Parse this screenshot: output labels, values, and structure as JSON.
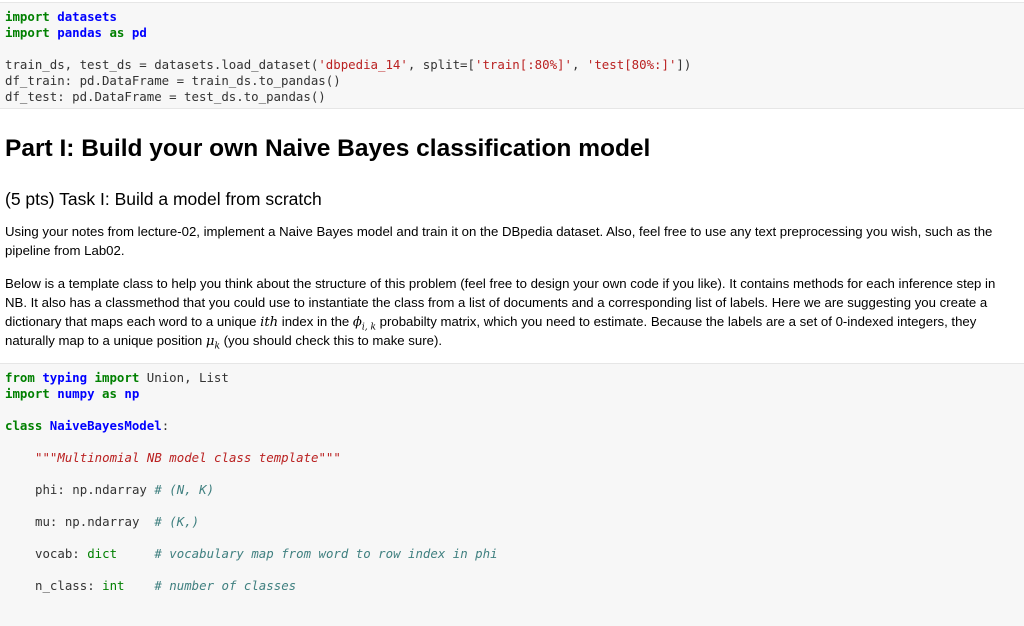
{
  "cell1": {
    "kw_import": "import",
    "mod_datasets": "datasets",
    "mod_pandas": "pandas",
    "kw_as": "as",
    "alias_pd": "pd",
    "load_pre": "train_ds, test_ds = datasets.load_dataset(",
    "str_name": "'dbpedia_14'",
    "split_pre": ", split=[",
    "str_train": "'train[:80%]'",
    "comma": ", ",
    "str_test": "'test[80%:]'",
    "close": "])",
    "df_train": "df_train: pd.DataFrame = train_ds.to_pandas()",
    "df_test": "df_test: pd.DataFrame = test_ds.to_pandas()"
  },
  "markdown": {
    "heading1": "Part I: Build your own Naive Bayes classification model",
    "heading3": "(5 pts) Task I: Build a model from scratch",
    "para1_line1": "Using your notes from lecture-02, implement a Naive Bayes model and train it on the DBpedia dataset. Also, feel free to use any text preprocessing you wish, such as the",
    "para1_line2": "pipeline from Lab02.",
    "para2_line1": "Below is a template class to help you think about the structure of this problem (feel free to design your own code if you like). It contains methods for each inference step in",
    "para2_line2": "NB. It also has a classmethod that you could use to instantiate the class from a list of documents and a corresponding list of labels. Here we are suggesting you create a",
    "para2_line3_a": "dictionary that maps each word to a unique ",
    "math_ith": "ith",
    "para2_line3_b": " index in the ",
    "math_phi": "ϕ",
    "math_phi_sub": "i, k",
    "para2_line3_c": " probabilty matrix, which you need to estimate. Because the labels are a set of 0-indexed integers, they",
    "para2_line4_a": "naturally map to a unique position ",
    "math_mu": "μ",
    "math_mu_sub": "k",
    "para2_line4_b": " (you should check this to make sure)."
  },
  "cell2": {
    "kw_from": "from",
    "mod_typing": "typing",
    "kw_import": "import",
    "typing_names": " Union, List",
    "mod_numpy": "numpy",
    "kw_as": "as",
    "alias_np": "np",
    "kw_class": "class",
    "class_name": "NaiveBayesModel",
    "colon": ":",
    "docstring": "\"\"\"Multinomial NB model class template\"\"\"",
    "phi_decl": "phi: np.ndarray ",
    "phi_comment": "# (N, K)",
    "mu_decl": "mu: np.ndarray  ",
    "mu_comment": "# (K,)",
    "vocab_decl": "vocab: ",
    "type_dict": "dict",
    "vocab_pad": "     ",
    "vocab_comment": "# vocabulary map from word to row index in phi",
    "nclass_decl": "n_class: ",
    "type_int": "int",
    "nclass_pad": "    ",
    "nclass_comment": "# number of classes"
  }
}
